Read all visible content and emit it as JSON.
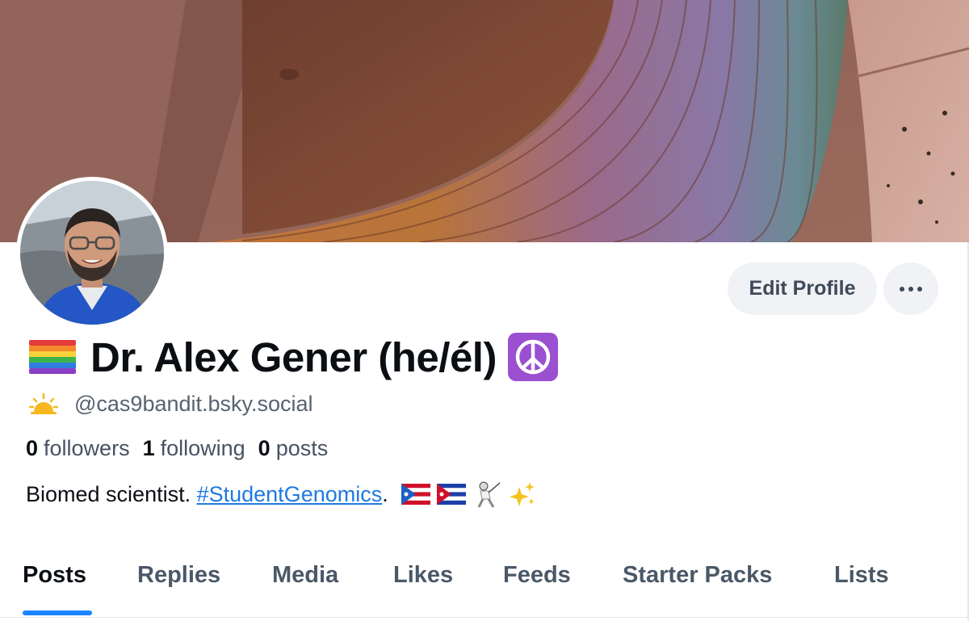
{
  "profile": {
    "name": "Dr. Alex Gener (he/él)",
    "handle": "@cas9bandit.bsky.social",
    "name_prefix_icon": "rainbow-flag-icon",
    "name_suffix_icon": "peace-symbol-icon",
    "handle_icon": "sunrise-icon"
  },
  "actions": {
    "edit_label": "Edit Profile",
    "more_icon": "ellipsis-icon"
  },
  "stats": [
    {
      "count": "0",
      "label": "followers"
    },
    {
      "count": "1",
      "label": "following"
    },
    {
      "count": "0",
      "label": "posts"
    }
  ],
  "bio": {
    "prefix": "Biomed scientist. ",
    "hashtag": "#StudentGenomics",
    "suffix": ".",
    "emoji_icons": [
      "puerto-rico-flag-icon",
      "cuba-flag-icon",
      "fencer-icon",
      "sparkles-icon"
    ]
  },
  "tabs": [
    {
      "label": "Posts",
      "active": true
    },
    {
      "label": "Replies",
      "active": false
    },
    {
      "label": "Media",
      "active": false
    },
    {
      "label": "Likes",
      "active": false
    },
    {
      "label": "Feeds",
      "active": false
    },
    {
      "label": "Starter Packs",
      "active": false
    },
    {
      "label": "Lists",
      "active": false
    }
  ],
  "colors": {
    "accent": "#1a83ff",
    "link": "#1f7ae0",
    "button_bg": "#f0f2f5",
    "peace_bg": "#9b4fd1"
  }
}
